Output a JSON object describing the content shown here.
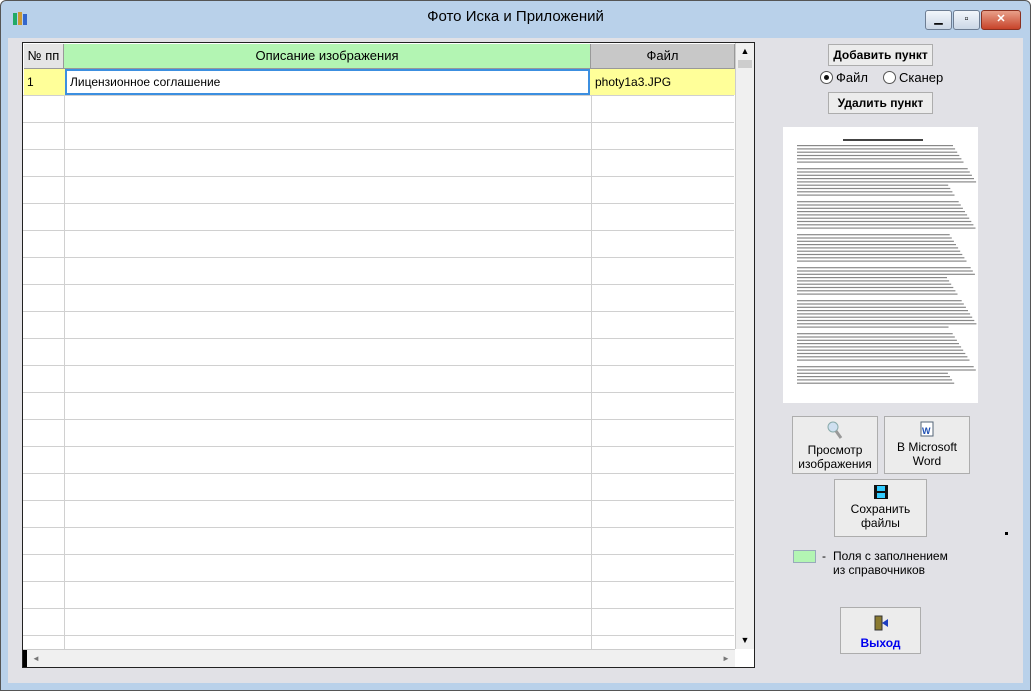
{
  "window": {
    "title": "Фото Иска и Приложений",
    "minimize": "▁",
    "maximize": "▫",
    "close": "✕"
  },
  "grid": {
    "columns": [
      "№ пп",
      "Описание изображения",
      "Файл"
    ],
    "rows": [
      {
        "num": "1",
        "description": "Лицензионное соглашение",
        "file": "photy1a3.JPG"
      }
    ],
    "header_highlight": "#b3f5b3",
    "selected_row_color": "#ffff99"
  },
  "actions": {
    "add": "Добавить пункт",
    "delete": "Удалить пункт",
    "radio_file": "Файл",
    "radio_scanner": "Сканер",
    "radio_selected": "Файл"
  },
  "buttons": {
    "view_line1": "Просмотр",
    "view_line2": "изображения",
    "word_line1": "В Microsoft",
    "word_line2": "Word",
    "save_line1": "Сохранить",
    "save_line2": "файлы",
    "exit": "Выход"
  },
  "legend": {
    "dash": "-",
    "line1": "Поля с заполнением",
    "line2": "из справочников"
  },
  "scroll": {
    "up": "▲",
    "down": "▼",
    "left": "◄",
    "right": "►"
  }
}
